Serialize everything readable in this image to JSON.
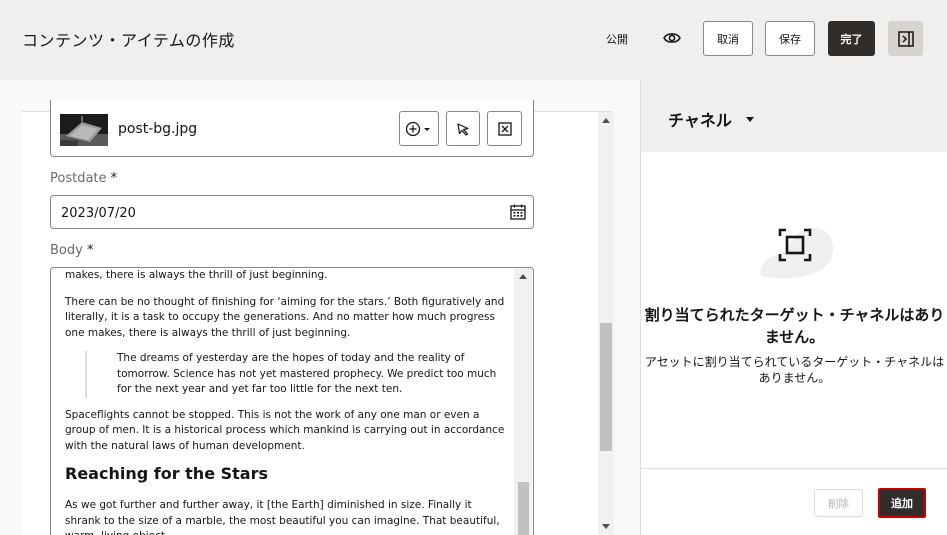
{
  "header": {
    "title": "コンテンツ・アイテムの作成",
    "publish_label": "公開",
    "cancel_label": "取消",
    "save_label": "保存",
    "done_label": "完了"
  },
  "form": {
    "media": {
      "filename": "post-bg.jpg"
    },
    "postdate": {
      "label": "Postdate",
      "required_mark": "*",
      "value": "2023/07/20"
    },
    "body": {
      "label": "Body",
      "required_mark": "*",
      "paragraphs": [
        "makes, there is always the thrill of just beginning.",
        "There can be no thought of finishing for ‘aiming for the stars.’ Both figuratively and literally, it is a task to occupy the generations. And no matter how much progress one makes, there is always the thrill of just beginning."
      ],
      "quote": "The dreams of yesterday are the hopes of today and the reality of tomorrow. Science has not yet mastered prophecy. We predict too much for the next year and yet far too little for the next ten.",
      "paragraph_after_quote": "Spaceflights cannot be stopped. This is not the work of any one man or even a group of men. It is a historical process which mankind is carrying out in accordance with the natural laws of human development.",
      "heading": "Reaching for the Stars",
      "paragraph_last": "As we got further and further away, it [the Earth] diminished in size. Finally it shrank to the size of a marble, the most beautiful you can imagine. That beautiful, warm, living object"
    }
  },
  "channels": {
    "selector_label": "チャネル",
    "empty_title": "割り当てられたターゲット・チャネルはありません。",
    "empty_description": "アセットに割り当てられているターゲット・チャネルはありません。",
    "remove_label": "削除",
    "add_label": "追加"
  },
  "colors": {
    "header_bg": "#f1efed",
    "primary_button": "#312d2a",
    "highlight_border": "#c40000"
  },
  "icons": [
    "eye-icon",
    "panel-toggle-icon",
    "add-circle-icon",
    "select-arrow-icon",
    "clear-icon",
    "calendar-icon",
    "channel-empty-icon"
  ]
}
